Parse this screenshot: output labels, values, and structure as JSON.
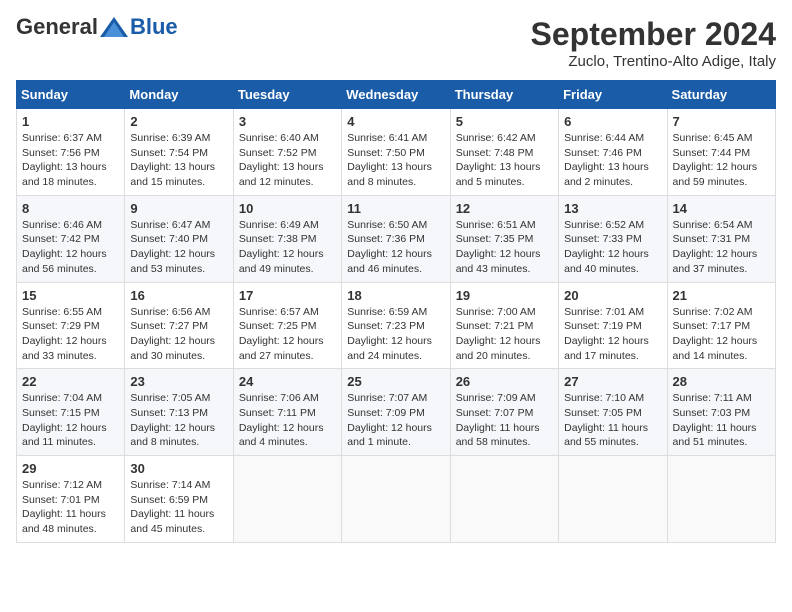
{
  "logo": {
    "general": "General",
    "blue": "Blue"
  },
  "title": "September 2024",
  "subtitle": "Zuclo, Trentino-Alto Adige, Italy",
  "days_header": [
    "Sunday",
    "Monday",
    "Tuesday",
    "Wednesday",
    "Thursday",
    "Friday",
    "Saturday"
  ],
  "weeks": [
    [
      {
        "day": "1",
        "sunrise": "6:37 AM",
        "sunset": "7:56 PM",
        "daylight": "13 hours and 18 minutes."
      },
      {
        "day": "2",
        "sunrise": "6:39 AM",
        "sunset": "7:54 PM",
        "daylight": "13 hours and 15 minutes."
      },
      {
        "day": "3",
        "sunrise": "6:40 AM",
        "sunset": "7:52 PM",
        "daylight": "13 hours and 12 minutes."
      },
      {
        "day": "4",
        "sunrise": "6:41 AM",
        "sunset": "7:50 PM",
        "daylight": "13 hours and 8 minutes."
      },
      {
        "day": "5",
        "sunrise": "6:42 AM",
        "sunset": "7:48 PM",
        "daylight": "13 hours and 5 minutes."
      },
      {
        "day": "6",
        "sunrise": "6:44 AM",
        "sunset": "7:46 PM",
        "daylight": "13 hours and 2 minutes."
      },
      {
        "day": "7",
        "sunrise": "6:45 AM",
        "sunset": "7:44 PM",
        "daylight": "12 hours and 59 minutes."
      }
    ],
    [
      {
        "day": "8",
        "sunrise": "6:46 AM",
        "sunset": "7:42 PM",
        "daylight": "12 hours and 56 minutes."
      },
      {
        "day": "9",
        "sunrise": "6:47 AM",
        "sunset": "7:40 PM",
        "daylight": "12 hours and 53 minutes."
      },
      {
        "day": "10",
        "sunrise": "6:49 AM",
        "sunset": "7:38 PM",
        "daylight": "12 hours and 49 minutes."
      },
      {
        "day": "11",
        "sunrise": "6:50 AM",
        "sunset": "7:36 PM",
        "daylight": "12 hours and 46 minutes."
      },
      {
        "day": "12",
        "sunrise": "6:51 AM",
        "sunset": "7:35 PM",
        "daylight": "12 hours and 43 minutes."
      },
      {
        "day": "13",
        "sunrise": "6:52 AM",
        "sunset": "7:33 PM",
        "daylight": "12 hours and 40 minutes."
      },
      {
        "day": "14",
        "sunrise": "6:54 AM",
        "sunset": "7:31 PM",
        "daylight": "12 hours and 37 minutes."
      }
    ],
    [
      {
        "day": "15",
        "sunrise": "6:55 AM",
        "sunset": "7:29 PM",
        "daylight": "12 hours and 33 minutes."
      },
      {
        "day": "16",
        "sunrise": "6:56 AM",
        "sunset": "7:27 PM",
        "daylight": "12 hours and 30 minutes."
      },
      {
        "day": "17",
        "sunrise": "6:57 AM",
        "sunset": "7:25 PM",
        "daylight": "12 hours and 27 minutes."
      },
      {
        "day": "18",
        "sunrise": "6:59 AM",
        "sunset": "7:23 PM",
        "daylight": "12 hours and 24 minutes."
      },
      {
        "day": "19",
        "sunrise": "7:00 AM",
        "sunset": "7:21 PM",
        "daylight": "12 hours and 20 minutes."
      },
      {
        "day": "20",
        "sunrise": "7:01 AM",
        "sunset": "7:19 PM",
        "daylight": "12 hours and 17 minutes."
      },
      {
        "day": "21",
        "sunrise": "7:02 AM",
        "sunset": "7:17 PM",
        "daylight": "12 hours and 14 minutes."
      }
    ],
    [
      {
        "day": "22",
        "sunrise": "7:04 AM",
        "sunset": "7:15 PM",
        "daylight": "12 hours and 11 minutes."
      },
      {
        "day": "23",
        "sunrise": "7:05 AM",
        "sunset": "7:13 PM",
        "daylight": "12 hours and 8 minutes."
      },
      {
        "day": "24",
        "sunrise": "7:06 AM",
        "sunset": "7:11 PM",
        "daylight": "12 hours and 4 minutes."
      },
      {
        "day": "25",
        "sunrise": "7:07 AM",
        "sunset": "7:09 PM",
        "daylight": "12 hours and 1 minute."
      },
      {
        "day": "26",
        "sunrise": "7:09 AM",
        "sunset": "7:07 PM",
        "daylight": "11 hours and 58 minutes."
      },
      {
        "day": "27",
        "sunrise": "7:10 AM",
        "sunset": "7:05 PM",
        "daylight": "11 hours and 55 minutes."
      },
      {
        "day": "28",
        "sunrise": "7:11 AM",
        "sunset": "7:03 PM",
        "daylight": "11 hours and 51 minutes."
      }
    ],
    [
      {
        "day": "29",
        "sunrise": "7:12 AM",
        "sunset": "7:01 PM",
        "daylight": "11 hours and 48 minutes."
      },
      {
        "day": "30",
        "sunrise": "7:14 AM",
        "sunset": "6:59 PM",
        "daylight": "11 hours and 45 minutes."
      },
      null,
      null,
      null,
      null,
      null
    ]
  ]
}
